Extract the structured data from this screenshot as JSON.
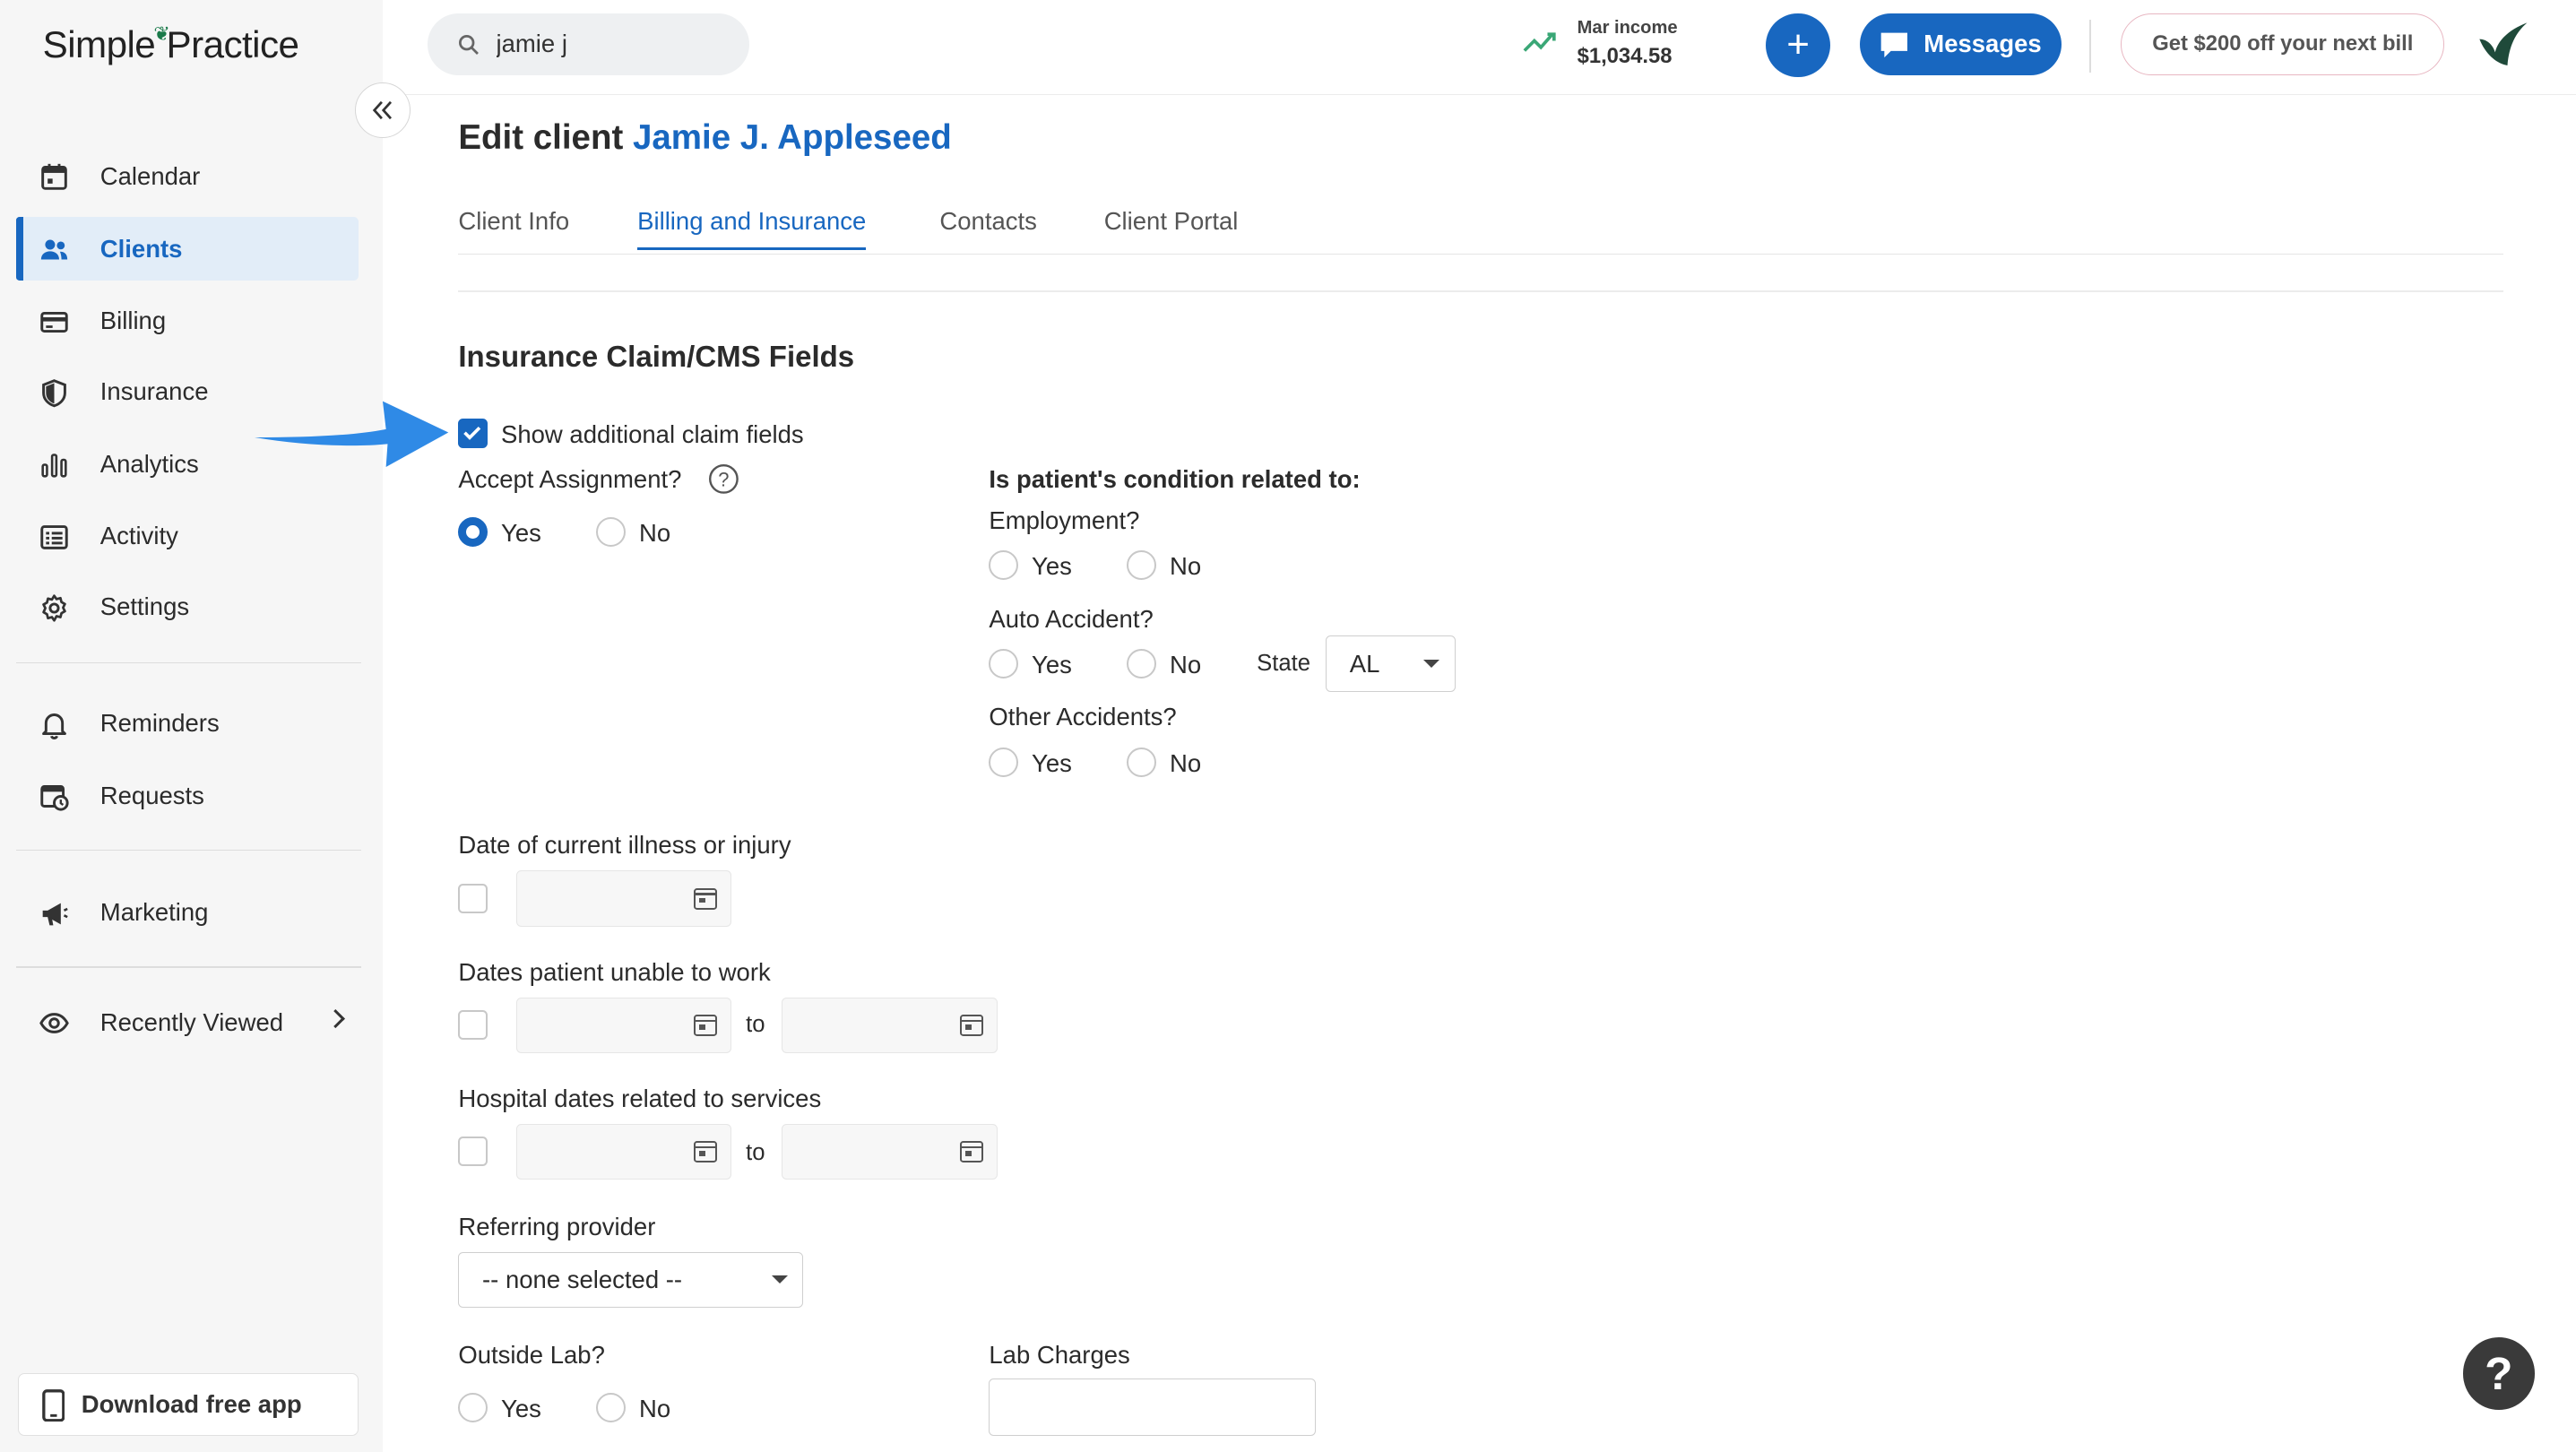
{
  "app": {
    "logo": "SimplePractice",
    "logo_pre": "Simple",
    "logo_post": "Practice"
  },
  "sidebar": {
    "items": [
      {
        "label": "Calendar",
        "icon": "calendar-icon"
      },
      {
        "label": "Clients",
        "icon": "users-icon",
        "active": true
      },
      {
        "label": "Billing",
        "icon": "credit-card-icon"
      },
      {
        "label": "Insurance",
        "icon": "shield-icon"
      },
      {
        "label": "Analytics",
        "icon": "bar-chart-icon"
      },
      {
        "label": "Activity",
        "icon": "list-icon"
      },
      {
        "label": "Settings",
        "icon": "gear-icon"
      },
      {
        "label": "Reminders",
        "icon": "bell-icon"
      },
      {
        "label": "Requests",
        "icon": "calendar-clock-icon"
      },
      {
        "label": "Marketing",
        "icon": "megaphone-icon"
      },
      {
        "label": "Recently Viewed",
        "icon": "eye-icon"
      }
    ],
    "download_label": "Download free app"
  },
  "topbar": {
    "search_value": "jamie j",
    "income_label": "Mar income",
    "income_value": "$1,034.58",
    "messages_label": "Messages",
    "promo_label": "Get $200 off your next bill",
    "plus_label": "+"
  },
  "page": {
    "title_prefix": "Edit client",
    "client_name": "Jamie J. Appleseed",
    "tabs": [
      "Client Info",
      "Billing and Insurance",
      "Contacts",
      "Client Portal"
    ],
    "active_tab": "Billing and Insurance",
    "section_title": "Insurance Claim/CMS Fields"
  },
  "form": {
    "show_additional_label": "Show additional claim fields",
    "show_additional_checked": true,
    "accept_assignment_label": "Accept Assignment?",
    "yes": "Yes",
    "no": "No",
    "accept_assignment_value": "Yes",
    "condition_heading": "Is patient's condition related to:",
    "employment_label": "Employment?",
    "auto_accident_label": "Auto Accident?",
    "state_label": "State",
    "state_value": "AL",
    "other_accidents_label": "Other Accidents?",
    "illness_date_label": "Date of current illness or injury",
    "unable_work_label": "Dates patient unable to work",
    "hospital_dates_label": "Hospital dates related to services",
    "to": "to",
    "referring_provider_label": "Referring provider",
    "referring_provider_value": "-- none selected --",
    "outside_lab_label": "Outside Lab?",
    "lab_charges_label": "Lab Charges",
    "lab_charges_value": ""
  },
  "help_label": "?",
  "colors": {
    "accent": "#1867c0",
    "arrow": "#2f8ae6",
    "sidebar_bg": "#f6f6f6",
    "active_bg": "#e2edf8"
  }
}
